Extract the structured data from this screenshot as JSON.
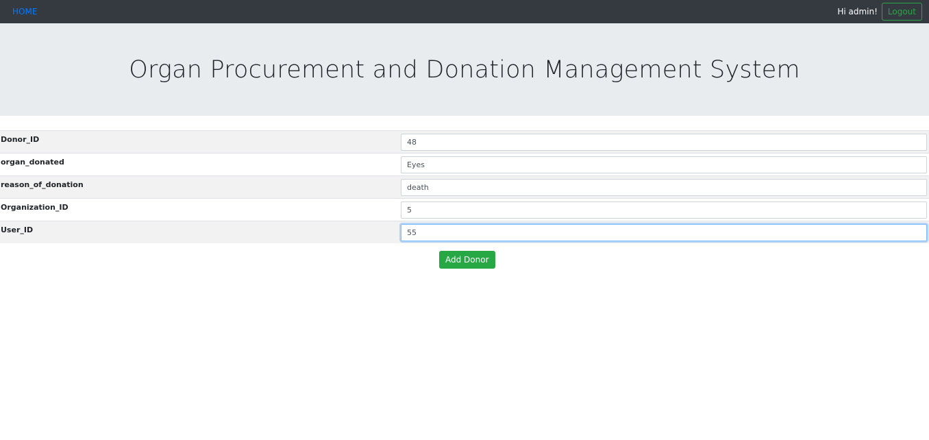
{
  "navbar": {
    "home_label": "HOME",
    "greeting": "Hi admin!",
    "logout_label": "Logout"
  },
  "jumbotron": {
    "title": "Organ Procurement and Donation Management System"
  },
  "form": {
    "fields": [
      {
        "label": "Donor_ID",
        "value": "48"
      },
      {
        "label": "organ_donated",
        "value": "Eyes"
      },
      {
        "label": "reason_of_donation",
        "value": "death"
      },
      {
        "label": "Organization_ID",
        "value": "5"
      },
      {
        "label": "User_ID",
        "value": "55"
      }
    ],
    "submit_label": "Add Donor"
  },
  "colors": {
    "navbar_bg": "#343a40",
    "link": "#007bff",
    "success": "#28a745",
    "jumbotron_bg": "#e9ecef"
  }
}
